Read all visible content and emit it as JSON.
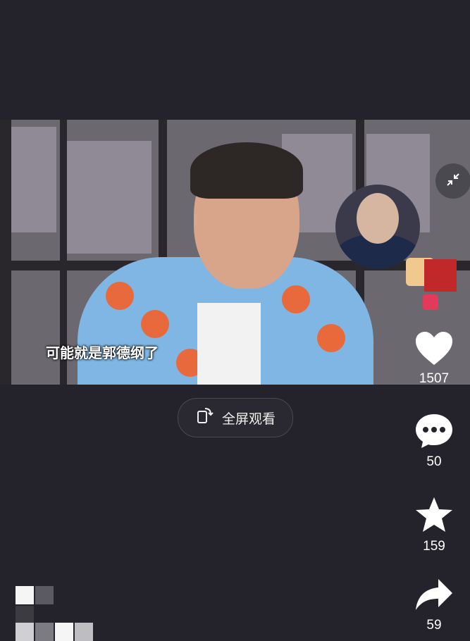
{
  "video": {
    "subtitle": "可能就是郭德纲了"
  },
  "controls": {
    "fullscreen_label": "全屏观看"
  },
  "actions": {
    "likes": "1507",
    "comments": "50",
    "favorites": "159",
    "shares": "59"
  },
  "icons": {
    "shrink": "shrink-icon",
    "rotate_phone": "rotate-phone-icon",
    "heart": "heart-icon",
    "comment": "comment-icon",
    "star": "star-icon",
    "share": "share-icon"
  },
  "colors": {
    "background": "#24222b",
    "shirt": "#7fb6e3",
    "flowers": "#e86a3c",
    "text": "#ffffff"
  }
}
